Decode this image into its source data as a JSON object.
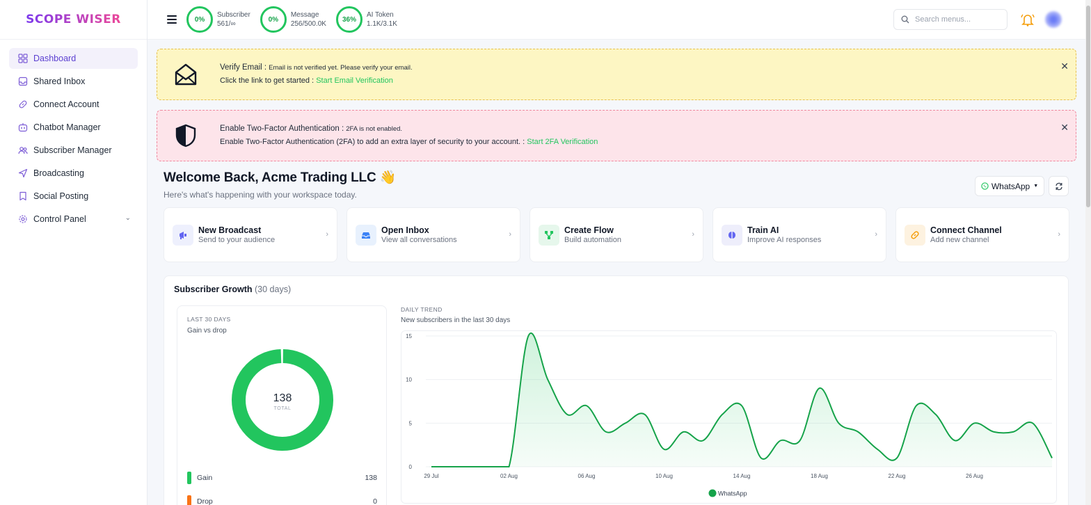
{
  "brand": {
    "logo_text": "SCOPE WISER"
  },
  "sidebar": {
    "items": [
      {
        "label": "Dashboard",
        "icon": "grid-icon",
        "active": true
      },
      {
        "label": "Shared Inbox",
        "icon": "inbox-icon"
      },
      {
        "label": "Connect Account",
        "icon": "link-icon"
      },
      {
        "label": "Chatbot Manager",
        "icon": "bot-icon"
      },
      {
        "label": "Subscriber Manager",
        "icon": "users-icon"
      },
      {
        "label": "Broadcasting",
        "icon": "send-icon"
      },
      {
        "label": "Social Posting",
        "icon": "bookmark-icon"
      },
      {
        "label": "Control Panel",
        "icon": "gear-icon",
        "expandable": true
      }
    ]
  },
  "topbar": {
    "stats": [
      {
        "percent": "0%",
        "label": "Subscriber",
        "value": "561/∞"
      },
      {
        "percent": "0%",
        "label": "Message",
        "value": "256/500.0K"
      },
      {
        "percent": "36%",
        "label": "AI Token",
        "value": "1.1K/3.1K"
      }
    ],
    "search_placeholder": "Search menus..."
  },
  "alerts": {
    "email": {
      "title": "Verify Email :",
      "message": "Email is not verified yet. Please verify your email.",
      "prompt": "Click the link to get started :",
      "link": "Start Email Verification"
    },
    "twofa": {
      "title": "Enable Two-Factor Authentication :",
      "message": "2FA is not enabled.",
      "prompt": "Enable Two-Factor Authentication (2FA) to add an extra layer of security to your account. :",
      "link": "Start 2FA Verification"
    }
  },
  "welcome": {
    "title": "Welcome Back, Acme Trading LLC 👋",
    "subtitle": "Here's what's happening with your workspace today."
  },
  "channel_select": {
    "value": "WhatsApp"
  },
  "quick_actions": [
    {
      "title": "New Broadcast",
      "subtitle": "Send to your audience",
      "color": "#6366f1",
      "bg": "#eef0fd"
    },
    {
      "title": "Open Inbox",
      "subtitle": "View all conversations",
      "color": "#3b82f6",
      "bg": "#e8f1fd"
    },
    {
      "title": "Create Flow",
      "subtitle": "Build automation",
      "color": "#22c55e",
      "bg": "#e6f7ec"
    },
    {
      "title": "Train AI",
      "subtitle": "Improve AI responses",
      "color": "#6366f1",
      "bg": "#eeeefb"
    },
    {
      "title": "Connect Channel",
      "subtitle": "Add new channel",
      "color": "#f59e0b",
      "bg": "#fdf2e0"
    }
  ],
  "growth": {
    "title": "Subscriber Growth",
    "period": "(30 days)",
    "donut": {
      "label": "LAST 30 DAYS",
      "sub": "Gain vs drop",
      "total": "138",
      "total_label": "TOTAL",
      "legend": [
        {
          "name": "Gain",
          "value": "138",
          "color": "#22c55e"
        },
        {
          "name": "Drop",
          "value": "0",
          "color": "#f97316"
        }
      ]
    },
    "trend": {
      "label": "DAILY TREND",
      "sub": "New subscribers in the last 30 days"
    }
  },
  "chart_data": [
    {
      "type": "pie",
      "categories": [
        "Gain",
        "Drop"
      ],
      "values": [
        138,
        0
      ],
      "colors": [
        "#22c55e",
        "#f97316"
      ]
    },
    {
      "type": "area",
      "x": [
        "29 Jul",
        "30 Jul",
        "31 Jul",
        "01 Aug",
        "02 Aug",
        "03 Aug",
        "04 Aug",
        "05 Aug",
        "06 Aug",
        "07 Aug",
        "08 Aug",
        "09 Aug",
        "10 Aug",
        "11 Aug",
        "12 Aug",
        "13 Aug",
        "14 Aug",
        "15 Aug",
        "16 Aug",
        "17 Aug",
        "18 Aug",
        "19 Aug",
        "20 Aug",
        "21 Aug",
        "22 Aug",
        "23 Aug",
        "24 Aug",
        "25 Aug",
        "26 Aug",
        "27 Aug",
        "28 Aug"
      ],
      "series": [
        {
          "name": "WhatsApp",
          "color": "#16a34a",
          "values": [
            0,
            0,
            0,
            0,
            0,
            15,
            10,
            6,
            7,
            4,
            5,
            6,
            2,
            4,
            3,
            6,
            7,
            1,
            3,
            3,
            9,
            5,
            4,
            2,
            1,
            7,
            6,
            3,
            5,
            4,
            4,
            5,
            1
          ]
        }
      ],
      "xticks": [
        "29 Jul",
        "02 Aug",
        "06 Aug",
        "10 Aug",
        "14 Aug",
        "18 Aug",
        "22 Aug",
        "26 Aug"
      ],
      "yticks": [
        0,
        5,
        10,
        15
      ],
      "ylim": [
        0,
        15
      ],
      "grid": true,
      "legend": "bottom"
    }
  ]
}
